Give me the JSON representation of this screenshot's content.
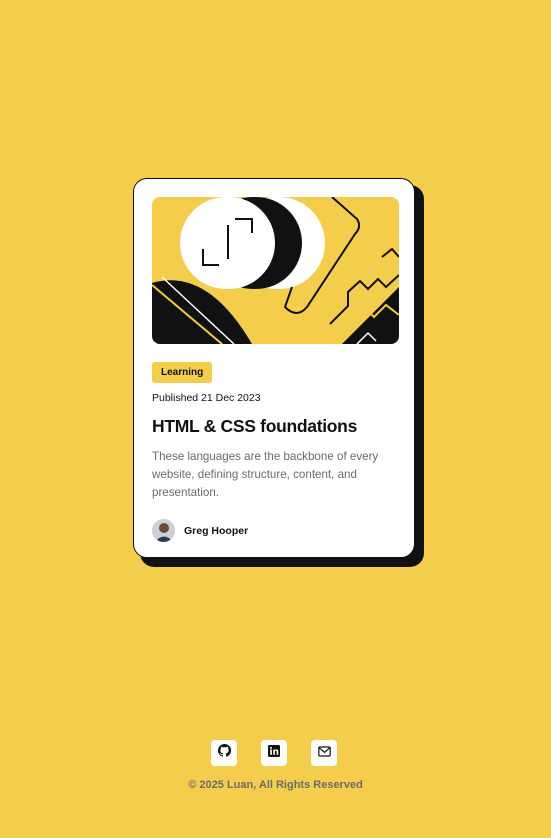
{
  "card": {
    "tag": "Learning",
    "published": "Published 21 Dec 2023",
    "title": "HTML & CSS foundations",
    "description": "These languages are the backbone of every website, defining structure, content, and presentation.",
    "author": "Greg Hooper"
  },
  "socials": [
    {
      "icon": "github-icon",
      "label": "GitHub"
    },
    {
      "icon": "linkedin-icon",
      "label": "LinkedIn"
    },
    {
      "icon": "mail-icon",
      "label": "Email"
    }
  ],
  "footer": {
    "text": "© 2025 Luan, All Rights Reserved"
  },
  "colors": {
    "background": "#f4cd4c",
    "card": "#ffffff",
    "ink": "#111111",
    "muted": "#6b6b6b"
  }
}
